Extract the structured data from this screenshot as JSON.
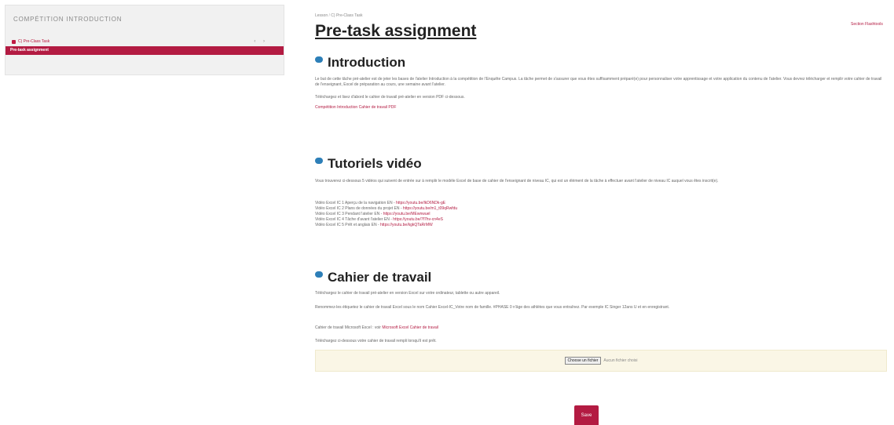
{
  "sidebar": {
    "title": "COMPÉTITION INTRODUCTION",
    "item_label": "C) Pre-Class Task",
    "item_controls": "‹ ›",
    "active_label": "Pre-task assignment"
  },
  "breadcrumb": {
    "root": "Lesson",
    "separator": "/",
    "current": "C) Pre-Class Task"
  },
  "page": {
    "title": "Pre-task assignment",
    "top_link": "Section Flashtools"
  },
  "sections": {
    "intro": {
      "heading": "Introduction",
      "text": "Le but de cette tâche pré-atelier est de jeter les bases de l'atelier Introduction à la compétition de l'Enquête Campus. La tâche permet de s'assurer que vous êtes suffisamment préparé(e) pour personnaliser votre apprentissage et votre application du contenu de l'atelier. Vous devrez télécharger et remplir votre cahier de travail de l'enseignant, Excel de préparation au cours, une semaine avant l'atelier.",
      "text2": "Téléchargez et lisez d'abord le cahier de travail pré-atelier en version PDF ci-dessous.",
      "link": "Compétition Introduction Cahier de travail PDF"
    },
    "videos": {
      "heading": "Tutoriels vidéo",
      "text": "Vous trouverez ci-dessous 5 vidéos qui suivent de entrée sur à remplir le modèle Excel de base de cahier de l'enseignant de niveau IC, qui est un élément de la tâche à effectuer avant l'atelier de niveau IC auquel vous êtes inscrit(e).",
      "items": [
        {
          "label": "Vidéo Excel IC 1 Aperçu de la navigation EN - ",
          "url": "https://youtu.be/lkD6NDk-gE"
        },
        {
          "label": "Vidéo Excel IC 2 Plans de données du projet EN - ",
          "url": "https://youtu.be/m1_t09qRwfdu"
        },
        {
          "label": "Vidéo Excel IC 3 Pendant l'atelier EN - ",
          "url": "https://youtu.be/MEwnwuel"
        },
        {
          "label": "Vidéo Excel IC 4 Tâche d'avant l'atelier EN - ",
          "url": "https://youtu.be/7f7hv-cn4eS"
        },
        {
          "label": "Vidéo Excel IC 5 Prêt et anglais EN - ",
          "url": "https://youtu.be/kgkQTaRrMW"
        }
      ]
    },
    "workbook": {
      "heading": "Cahier de travail",
      "text1": "Téléchargez le cahier de travail pré-atelier en version Excel sur votre ordinateur, tablette ou autre appareil.",
      "text2": "Renommez-les étiquetez le cahier de travail Excel sous le nom Cahier Excel-IC_Votre nom de famille. #PHASE 0 n'âge des athlètes que vous entraînez. Par exemple IC Singer 12ans U et en enregistrant.",
      "text3_prefix": "Cahier de travail Microsoft Excel : voir ",
      "text3_link": "Microsoft Excel Cahier de travail",
      "text4": "Téléchargez ci-dessous votre cahier de travail rempli lorsqu'il est prêt."
    }
  },
  "upload": {
    "button_label": "Choose un fichier",
    "status": "Aucun fichier choisi"
  },
  "actions": {
    "save_label": "Save"
  },
  "colors": {
    "accent": "#b31b42",
    "badge": "#2d7fb8",
    "upload_bg": "#faf6e6"
  }
}
